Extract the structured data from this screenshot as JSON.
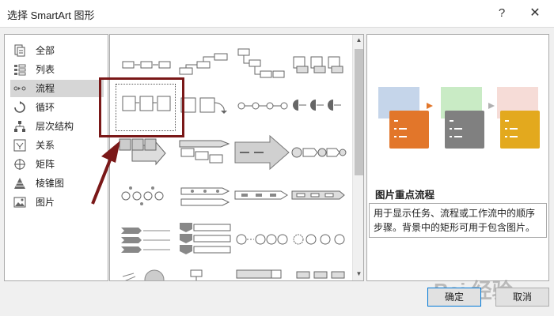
{
  "window": {
    "title": "选择 SmartArt 图形",
    "help": "?",
    "close": "✕"
  },
  "categories": [
    {
      "label": "全部",
      "icon": "all-icon"
    },
    {
      "label": "列表",
      "icon": "list-icon"
    },
    {
      "label": "流程",
      "icon": "process-icon",
      "selected": true
    },
    {
      "label": "循环",
      "icon": "cycle-icon"
    },
    {
      "label": "层次结构",
      "icon": "hierarchy-icon"
    },
    {
      "label": "关系",
      "icon": "relationship-icon"
    },
    {
      "label": "矩阵",
      "icon": "matrix-icon"
    },
    {
      "label": "棱锥图",
      "icon": "pyramid-icon"
    },
    {
      "label": "图片",
      "icon": "picture-icon"
    }
  ],
  "preview": {
    "title": "图片重点流程",
    "description": "用于显示任务、流程或工作流中的顺序步骤。背景中的矩形可用于包含图片。",
    "colors": {
      "blue": "#c5d5ea",
      "orange": "#e2762a",
      "green": "#c9ebc5",
      "gray": "#808080",
      "pink": "#f6dcd7",
      "gold": "#e3a91e",
      "arrow1": "#e2762a",
      "arrow2": "#b0b0b0"
    }
  },
  "buttons": {
    "ok": "确定",
    "cancel": "取消"
  },
  "watermark": "Bai 经验"
}
